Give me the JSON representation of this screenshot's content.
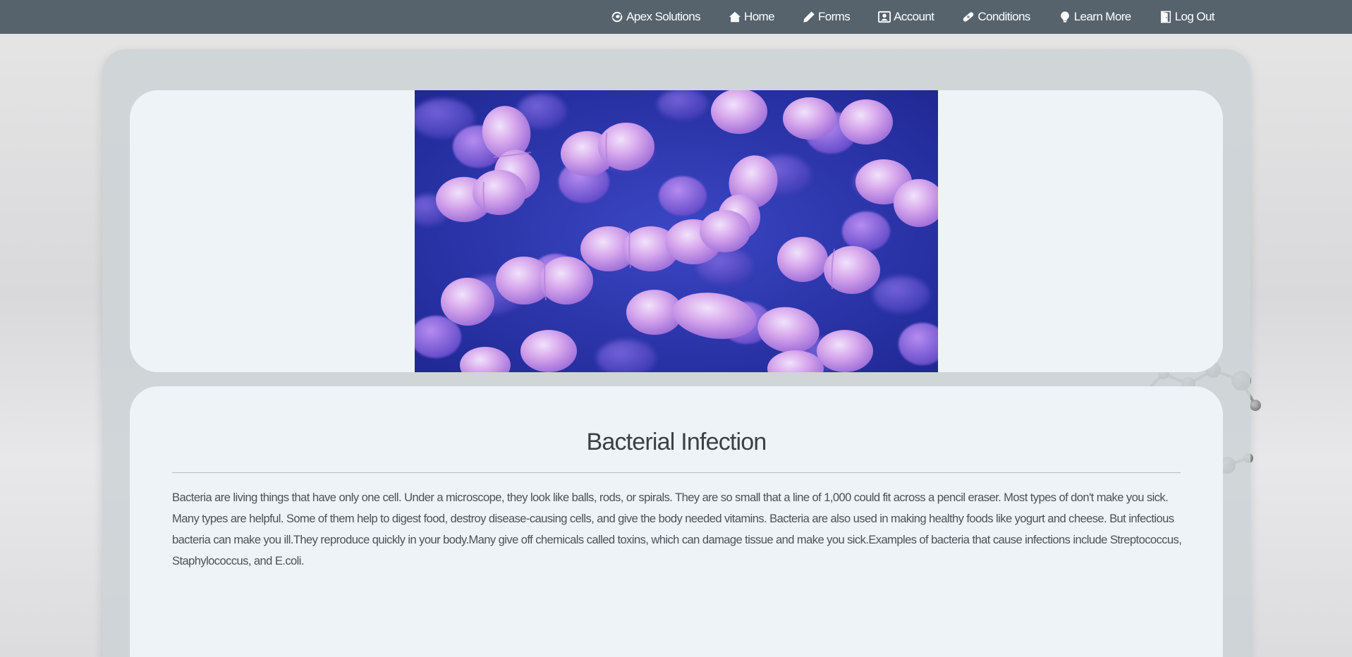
{
  "nav": {
    "items": [
      {
        "label": "Apex Solutions",
        "icon": "swirl-logo-icon"
      },
      {
        "label": "Home",
        "icon": "home-icon"
      },
      {
        "label": "Forms",
        "icon": "pencil-icon"
      },
      {
        "label": "Account",
        "icon": "user-badge-icon"
      },
      {
        "label": "Conditions",
        "icon": "bandage-icon"
      },
      {
        "label": "Learn More",
        "icon": "lightbulb-icon"
      },
      {
        "label": "Log Out",
        "icon": "door-icon"
      }
    ]
  },
  "colors": {
    "navbar": "#56636d",
    "card": "#eef3f7",
    "bacteria_bg": "#3a3fae",
    "bacteria_cell": "#c79be0"
  },
  "article": {
    "title": "Bacterial Infection",
    "body": "Bacteria are living things that have only one cell. Under a microscope, they look like balls, rods, or spirals. They are so small that a line of 1,000 could fit across a pencil eraser. Most types of don't make you sick. Many types are helpful. Some of them help to digest food, destroy disease-causing cells, and give the body needed vitamins. Bacteria are also used in making healthy foods like yogurt and cheese. But infectious bacteria can make you ill.They reproduce quickly in your body.Many give off chemicals called toxins, which can damage tissue and make you sick.Examples of bacteria that cause infections include Streptococcus, Staphylococcus, and E.coli."
  }
}
